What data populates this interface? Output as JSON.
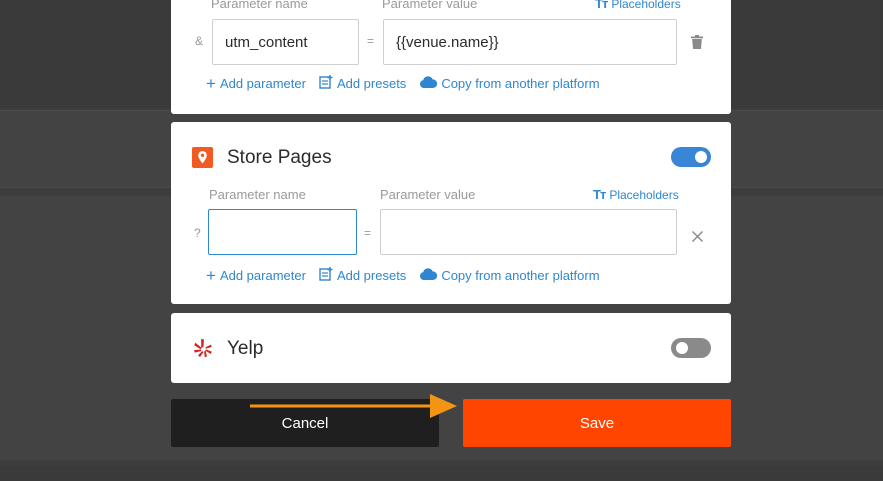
{
  "card1": {
    "param_name_label": "Parameter name",
    "param_value_label": "Parameter value",
    "placeholders_label": "Placeholders",
    "prefix_symbol": "&",
    "equals_symbol": "=",
    "param_name_value": "utm_content",
    "param_value_value": "{{venue.name}}",
    "add_parameter": "Add parameter",
    "add_presets": "Add presets",
    "copy_platform": "Copy from another platform"
  },
  "card2": {
    "title": "Store Pages",
    "enabled": true,
    "param_name_label": "Parameter name",
    "param_value_label": "Parameter value",
    "placeholders_label": "Placeholders",
    "prefix_symbol": "?",
    "equals_symbol": "=",
    "param_name_value": "",
    "param_value_value": "",
    "add_parameter": "Add parameter",
    "add_presets": "Add presets",
    "copy_platform": "Copy from another platform"
  },
  "card3": {
    "title": "Yelp",
    "enabled": false
  },
  "footer": {
    "cancel_label": "Cancel",
    "save_label": "Save"
  },
  "colors": {
    "accent": "#2f86d0",
    "save": "#ff4500",
    "cancel": "#1f1f1f",
    "arrow": "#f39415"
  },
  "icons": {
    "store_pages": "map-pin-icon",
    "yelp": "yelp-icon",
    "delete": "trash-icon",
    "remove": "close-icon",
    "placeholders": "text-size-icon",
    "add": "plus-icon",
    "presets": "note-add-icon",
    "copy": "cloud-icon"
  }
}
